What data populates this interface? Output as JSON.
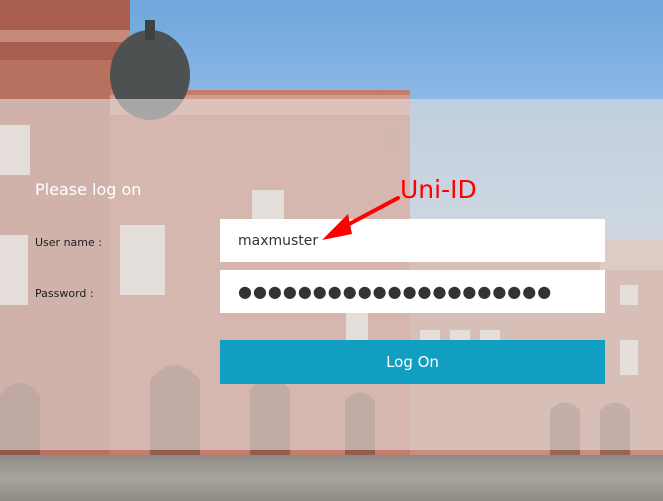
{
  "login": {
    "heading": "Please log on",
    "username_label": "User name :",
    "password_label": "Password :",
    "username_value": "maxmuster",
    "password_value": "●●●●●●●●●●●●●●●●●●●●●",
    "submit_label": "Log On"
  },
  "annotation": {
    "text": "Uni-ID",
    "color": "#ff0000"
  },
  "colors": {
    "button": "#109fc1",
    "panel_overlay": "rgba(225,220,218,0.62)"
  }
}
